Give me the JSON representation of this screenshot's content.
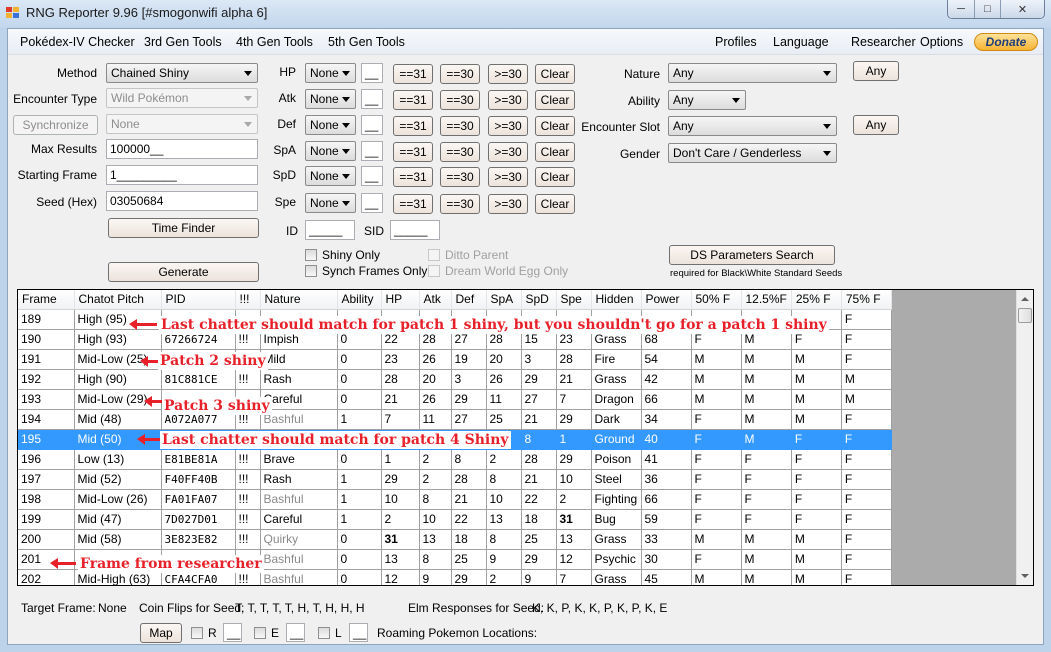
{
  "window": {
    "title": "RNG Reporter 9.96 [#smogonwifi alpha 6]",
    "buttons": [
      "minimize",
      "maximize",
      "close"
    ]
  },
  "menu": {
    "left": [
      "Pokédex-IV Checker",
      "3rd Gen Tools",
      "4th Gen Tools",
      "5th Gen Tools"
    ],
    "right": [
      "Profiles",
      "Language",
      "Researcher",
      "Options"
    ],
    "donate": "Donate"
  },
  "left_panel": {
    "method_label": "Method",
    "method_value": "Chained Shiny",
    "encounter_label": "Encounter Type",
    "encounter_value": "Wild Pokémon",
    "synchronize_label": "Synchronize",
    "synchronize_value": "None",
    "max_results_label": "Max Results",
    "max_results_value": "100000__",
    "starting_frame_label": "Starting Frame",
    "starting_frame_value": "1_________",
    "seed_label": "Seed (Hex)",
    "seed_value": "03050684",
    "time_finder": "Time Finder",
    "generate": "Generate"
  },
  "iv_filters": {
    "rows": [
      {
        "stat": "HP",
        "op": "None",
        "value": "__"
      },
      {
        "stat": "Atk",
        "op": "None",
        "value": "__"
      },
      {
        "stat": "Def",
        "op": "None",
        "value": "__"
      },
      {
        "stat": "SpA",
        "op": "None",
        "value": "__"
      },
      {
        "stat": "SpD",
        "op": "None",
        "value": "__"
      },
      {
        "stat": "Spe",
        "op": "None",
        "value": "__"
      }
    ],
    "btn_eq31": "==31",
    "btn_eq30": "==30",
    "btn_ge30": ">=30",
    "btn_clear": "Clear",
    "id_label": "ID",
    "id_value": "_____",
    "sid_label": "SID",
    "sid_value": "_____",
    "shiny_only": "Shiny Only",
    "synch_frames_only": "Synch Frames Only",
    "ditto_parent": "Ditto Parent",
    "dream_world_egg_only": "Dream World Egg Only"
  },
  "right_panel": {
    "nature_label": "Nature",
    "nature_value": "Any",
    "nature_any_btn": "Any",
    "ability_label": "Ability",
    "ability_value": "Any",
    "slot_label": "Encounter Slot",
    "slot_value": "Any",
    "slot_any_btn": "Any",
    "gender_label": "Gender",
    "gender_value": "Don't Care / Genderless",
    "ds_params_btn": "DS Parameters Search",
    "ds_params_note": "required for Black\\White Standard Seeds"
  },
  "table": {
    "columns": [
      "Frame",
      "Chatot Pitch",
      "PID",
      "!!!",
      "Nature",
      "Ability",
      "HP",
      "Atk",
      "Def",
      "SpA",
      "SpD",
      "Spe",
      "Hidden",
      "Power",
      "50% F",
      "12.5%F",
      "25% F",
      "75% F"
    ],
    "selected_frame": "195",
    "rows": [
      [
        "189",
        "High (95)",
        "",
        "",
        "",
        "",
        "",
        "",
        "",
        "",
        "",
        "",
        "",
        "",
        "",
        "",
        "",
        "F"
      ],
      [
        "190",
        "High (93)",
        "67266724",
        "!!!",
        "Impish",
        "0",
        "22",
        "28",
        "27",
        "28",
        "15",
        "23",
        "Grass",
        "68",
        "F",
        "M",
        "F",
        "F"
      ],
      [
        "191",
        "Mid-Low (25)",
        "",
        "",
        "Mild",
        "0",
        "23",
        "26",
        "19",
        "20",
        "3",
        "28",
        "Fire",
        "54",
        "M",
        "M",
        "M",
        "F"
      ],
      [
        "192",
        "High (90)",
        "81C881CE",
        "!!!",
        "Rash",
        "0",
        "28",
        "20",
        "3",
        "26",
        "29",
        "21",
        "Grass",
        "42",
        "M",
        "M",
        "M",
        "M"
      ],
      [
        "193",
        "Mid-Low (29)",
        "",
        "",
        "Careful",
        "0",
        "21",
        "26",
        "29",
        "11",
        "27",
        "7",
        "Dragon",
        "66",
        "M",
        "M",
        "M",
        "M"
      ],
      [
        "194",
        "Mid (48)",
        "A072A077",
        "!!!",
        "Bashful",
        "1",
        "7",
        "11",
        "27",
        "25",
        "21",
        "29",
        "Dark",
        "34",
        "F",
        "M",
        "M",
        "F"
      ],
      [
        "195",
        "Mid (50)",
        "",
        "",
        "",
        "",
        "",
        "",
        "",
        "",
        "8",
        "1",
        "Ground",
        "40",
        "F",
        "M",
        "F",
        "F"
      ],
      [
        "196",
        "Low (13)",
        "E81BE81A",
        "!!!",
        "Brave",
        "0",
        "1",
        "2",
        "8",
        "2",
        "28",
        "29",
        "Poison",
        "41",
        "F",
        "F",
        "F",
        "F"
      ],
      [
        "197",
        "Mid (52)",
        "F40FF40B",
        "!!!",
        "Rash",
        "1",
        "29",
        "2",
        "28",
        "8",
        "21",
        "10",
        "Steel",
        "36",
        "F",
        "F",
        "F",
        "F"
      ],
      [
        "198",
        "Mid-Low (26)",
        "FA01FA07",
        "!!!",
        "Bashful",
        "1",
        "10",
        "8",
        "21",
        "10",
        "22",
        "2",
        "Fighting",
        "66",
        "F",
        "F",
        "F",
        "F"
      ],
      [
        "199",
        "Mid (47)",
        "7D027D01",
        "!!!",
        "Careful",
        "1",
        "2",
        "10",
        "22",
        "13",
        "18",
        "31",
        "Bug",
        "59",
        "F",
        "F",
        "F",
        "F"
      ],
      [
        "200",
        "Mid (58)",
        "3E823E82",
        "!!!",
        "Quirky",
        "0",
        "31",
        "13",
        "18",
        "8",
        "25",
        "13",
        "Grass",
        "33",
        "M",
        "M",
        "M",
        "F"
      ],
      [
        "201",
        "",
        "",
        "",
        "Bashful",
        "0",
        "13",
        "8",
        "25",
        "9",
        "29",
        "12",
        "Psychic",
        "30",
        "F",
        "M",
        "M",
        "F"
      ],
      [
        "202",
        "Mid-High (63)",
        "CFA4CFA0",
        "!!!",
        "Bashful",
        "0",
        "12",
        "9",
        "29",
        "2",
        "9",
        "7",
        "Grass",
        "45",
        "M",
        "M",
        "M",
        "F"
      ]
    ]
  },
  "annotations": {
    "a1": "Last chatter should match for patch 1 shiny, but you shouldn't go for a patch 1 shiny",
    "a2": "Patch 2 shiny",
    "a3": "Patch 3 shiny",
    "a4": "Last chatter should match for patch 4 Shiny",
    "a5": "Frame from researcher"
  },
  "status": {
    "target_frame_label": "Target Frame:",
    "target_frame_value": "None",
    "coin_flips_label": "Coin Flips for Seed:",
    "coin_flips_value": "T, T, T, T, T, H, T, H, H, H",
    "elm_label": "Elm Responses for Seed:",
    "elm_value": "K, K, P, K, K, P, K, P, K, E",
    "map_btn": "Map",
    "roam_r": "R",
    "roam_e": "E",
    "roam_l": "L",
    "roam_value": "__",
    "roaming_label": "Roaming Pokemon Locations:"
  },
  "colors": {
    "selection": "#3399ff",
    "annotation": "#e8202a",
    "donate": "#f7b332"
  }
}
